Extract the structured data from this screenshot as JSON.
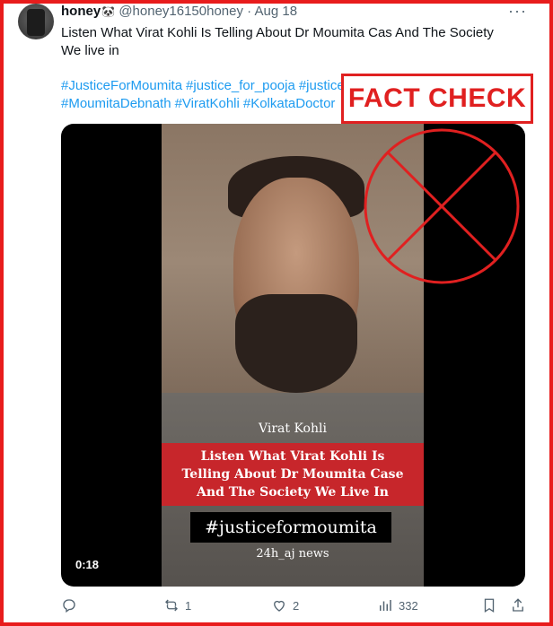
{
  "tweet": {
    "display_name": "honey",
    "handle": "@honey16150honey",
    "separator": "·",
    "date": "Aug 18",
    "more": "···",
    "text_line1": "Listen What Virat Kohli Is Telling About Dr Moumita Cas And The Society",
    "text_line2": "We live in",
    "hashtags_line1": [
      "#JusticeForMoumita",
      "#justice_for_pooja",
      "#justicef"
    ],
    "hashtags_line2": [
      "#MoumitaDebnath",
      "#ViratKohli",
      "#KolkataDoctor"
    ]
  },
  "overlay": {
    "fact_check_label": "FACT CHECK",
    "no_sign_color": "#e02020"
  },
  "video": {
    "name_label": "Virat Kohli",
    "banner_line1": "Listen What Virat Kohli Is",
    "banner_line2": "Telling About Dr Moumita Case",
    "banner_line3": "And The Society We Live In",
    "hashtag": "#justiceformoumita",
    "source": "24h_aj news",
    "duration": "0:18",
    "banner_color": "#c7262b"
  },
  "actions": {
    "reply_icon": "reply-icon",
    "retweet_icon": "retweet-icon",
    "retweets": "1",
    "like_icon": "heart-icon",
    "likes": "2",
    "views_icon": "views-icon",
    "views": "332",
    "bookmark_icon": "bookmark-icon",
    "share_icon": "share-icon"
  },
  "colors": {
    "frame": "#e81c1c",
    "link": "#1d9bf0",
    "muted": "#536471"
  }
}
